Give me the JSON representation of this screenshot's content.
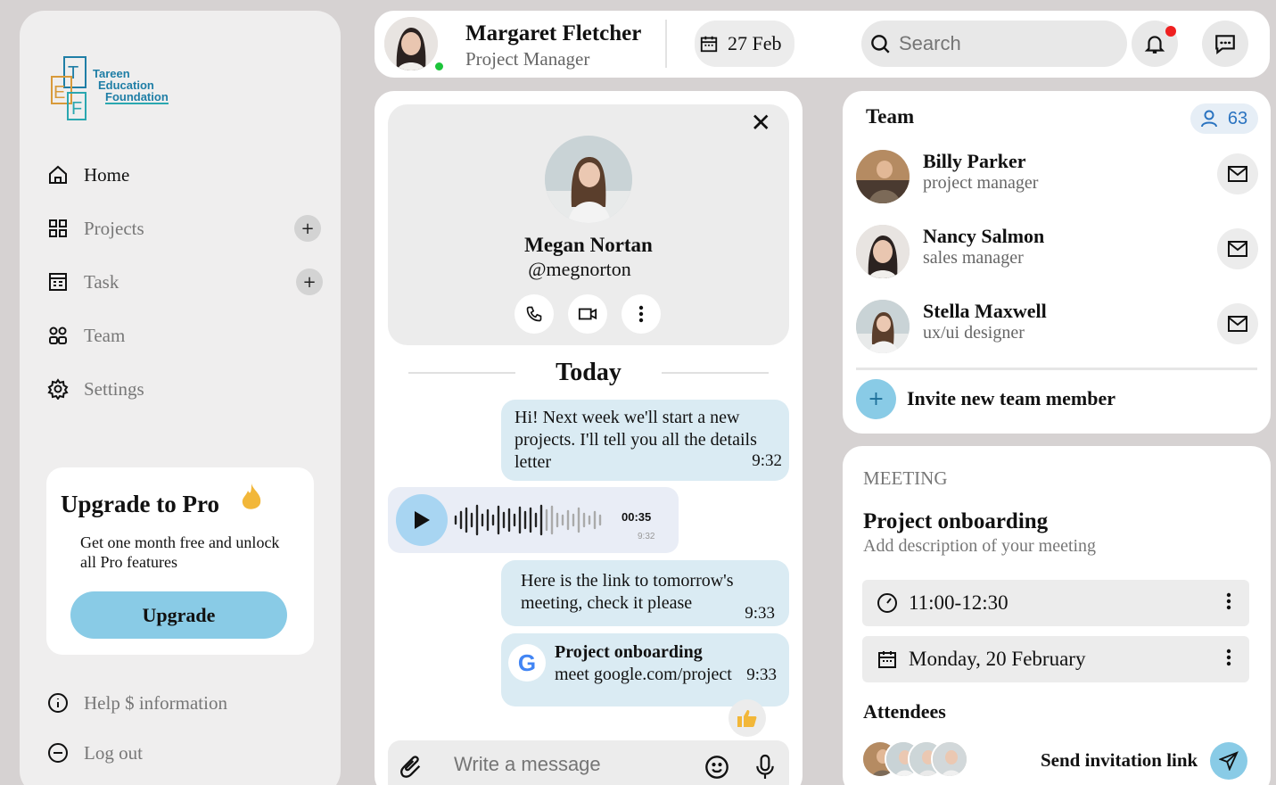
{
  "brand": {
    "logo_lines": [
      "Tareen",
      "Education",
      "Foundation"
    ],
    "logo_letters": [
      "T",
      "E",
      "F"
    ]
  },
  "sidebar": {
    "items": [
      {
        "label": "Home",
        "icon": "home-icon",
        "active": true
      },
      {
        "label": "Projects",
        "icon": "grid-icon",
        "add": true
      },
      {
        "label": "Task",
        "icon": "task-icon",
        "add": true
      },
      {
        "label": "Team",
        "icon": "team-icon"
      },
      {
        "label": "Settings",
        "icon": "gear-icon"
      }
    ],
    "add_glyph": "+",
    "upgrade": {
      "title": "Upgrade to Pro",
      "text": "Get one month free and unlock all Pro features",
      "button": "Upgrade",
      "icon": "flame-icon"
    },
    "help_label": "Help $ information",
    "logout_label": "Log out"
  },
  "header": {
    "user_name": "Margaret Fletcher",
    "user_role": "Project Manager",
    "status": "online",
    "date": "27 Feb",
    "search_placeholder": "Search",
    "has_notification": true
  },
  "chat": {
    "contact_name": "Megan Nortan",
    "contact_handle": "@megnorton",
    "close_glyph": "✕",
    "day_label": "Today",
    "messages": [
      {
        "text": "Hi! Next week we'll start a new projects. I'll tell you all the details letter",
        "time": "9:32"
      },
      {
        "type": "voice",
        "duration": "00:35",
        "time": "9:32"
      },
      {
        "text": "Here is the link to tomorrow's meeting, check it please",
        "time": "9:33"
      },
      {
        "type": "link",
        "title": "Project onboarding",
        "url": "meet google.com/project",
        "time": "9:33",
        "badge": "G"
      }
    ],
    "composer_placeholder": "Write a message"
  },
  "team": {
    "title": "Team",
    "count": "63",
    "members": [
      {
        "name": "Billy Parker",
        "role": "project manager"
      },
      {
        "name": "Nancy Salmon",
        "role": "sales manager"
      },
      {
        "name": "Stella Maxwell",
        "role": "ux/ui designer"
      }
    ],
    "invite_glyph": "+",
    "invite_label": "Invite new team member"
  },
  "meeting": {
    "label": "MEETING",
    "title": "Project onboarding",
    "description": "Add description of your meeting",
    "time": "11:00-12:30",
    "date": "Monday, 20 February",
    "attendees_label": "Attendees",
    "attendee_count": 4,
    "send_label": "Send invitation link"
  },
  "colors": {
    "accent": "#89cbe6",
    "bubble": "#daebf3",
    "online": "#1cc43a",
    "notification": "#ef2020",
    "background": "#d6d2d2"
  }
}
